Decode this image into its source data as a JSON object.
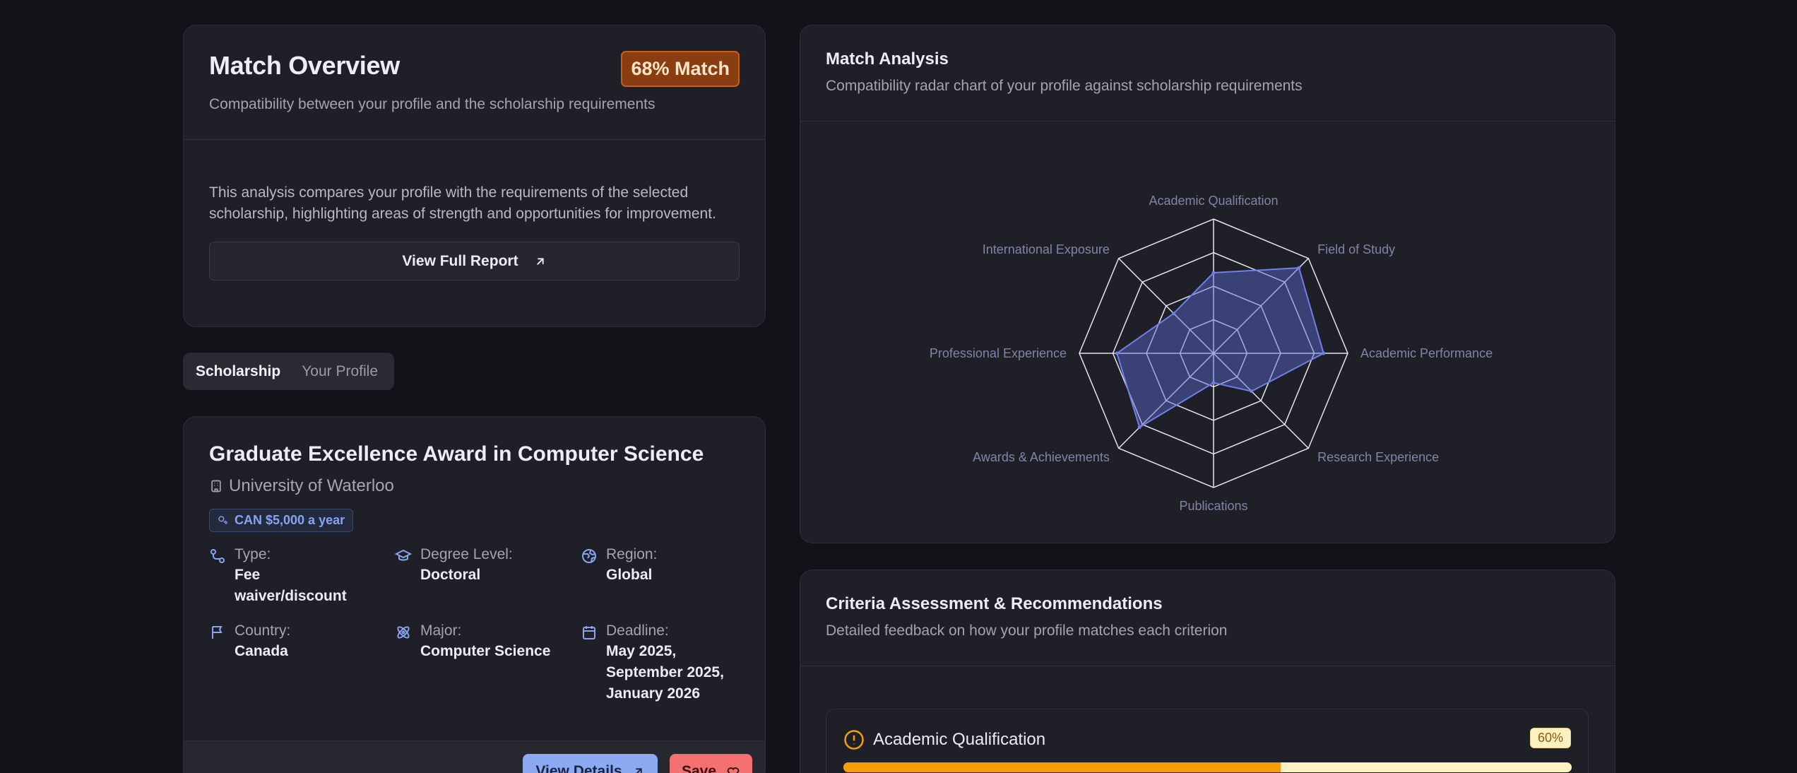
{
  "overview": {
    "title": "Match Overview",
    "badge": "68% Match",
    "subtitle": "Compatibility between your profile and the scholarship requirements",
    "description": "This analysis compares your profile with the requirements of the selected scholarship, highlighting areas of strength and opportunities for improvement.",
    "report_button": "View Full Report"
  },
  "tabs": [
    {
      "label": "Scholarship",
      "active": true
    },
    {
      "label": "Your Profile",
      "active": false
    }
  ],
  "scholarship": {
    "title": "Graduate Excellence Award in Computer Science",
    "university": "University of Waterloo",
    "amount": "CAN $5,000 a year",
    "fields": [
      {
        "label": "Type:",
        "value": "Fee waiver/discount",
        "icon": "route-icon"
      },
      {
        "label": "Degree Level:",
        "value": "Doctoral",
        "icon": "graduation-cap-icon"
      },
      {
        "label": "Region:",
        "value": "Global",
        "icon": "globe-icon"
      },
      {
        "label": "Country:",
        "value": "Canada",
        "icon": "flag-icon"
      },
      {
        "label": "Major:",
        "value": "Computer Science",
        "icon": "atom-icon"
      },
      {
        "label": "Deadline:",
        "value": "May 2025, September 2025, January 2026",
        "icon": "calendar-icon"
      }
    ],
    "view_button": "View Details",
    "save_button": "Save"
  },
  "analysis": {
    "title": "Match Analysis",
    "subtitle": "Compatibility radar chart of your profile against scholarship requirements"
  },
  "chart_data": {
    "type": "radar",
    "axes": [
      "Academic Qualification",
      "Field of Study",
      "Academic Performance",
      "Research Experience",
      "Publications",
      "Awards & Achievements",
      "Professional Experience",
      "International Exposure"
    ],
    "values": [
      60,
      90,
      82,
      40,
      22,
      78,
      72,
      42
    ],
    "range": [
      0,
      100
    ],
    "rings": 4,
    "colors": {
      "fill": "#5b6ad0",
      "stroke": "#6f7fe6",
      "grid": "#e6e6ee",
      "label": "#7f85a6"
    }
  },
  "criteria": {
    "title": "Criteria Assessment & Recommendations",
    "subtitle": "Detailed feedback on how your profile matches each criterion",
    "items": [
      {
        "name": "Academic Qualification",
        "percent": "60%",
        "value": 0.6,
        "icon": "alert-circle-icon"
      }
    ]
  },
  "colors": {
    "accent": "#86a4ef",
    "warning": "#f59e0b",
    "badge_bg": "#8a3d10",
    "save": "#f37171"
  }
}
